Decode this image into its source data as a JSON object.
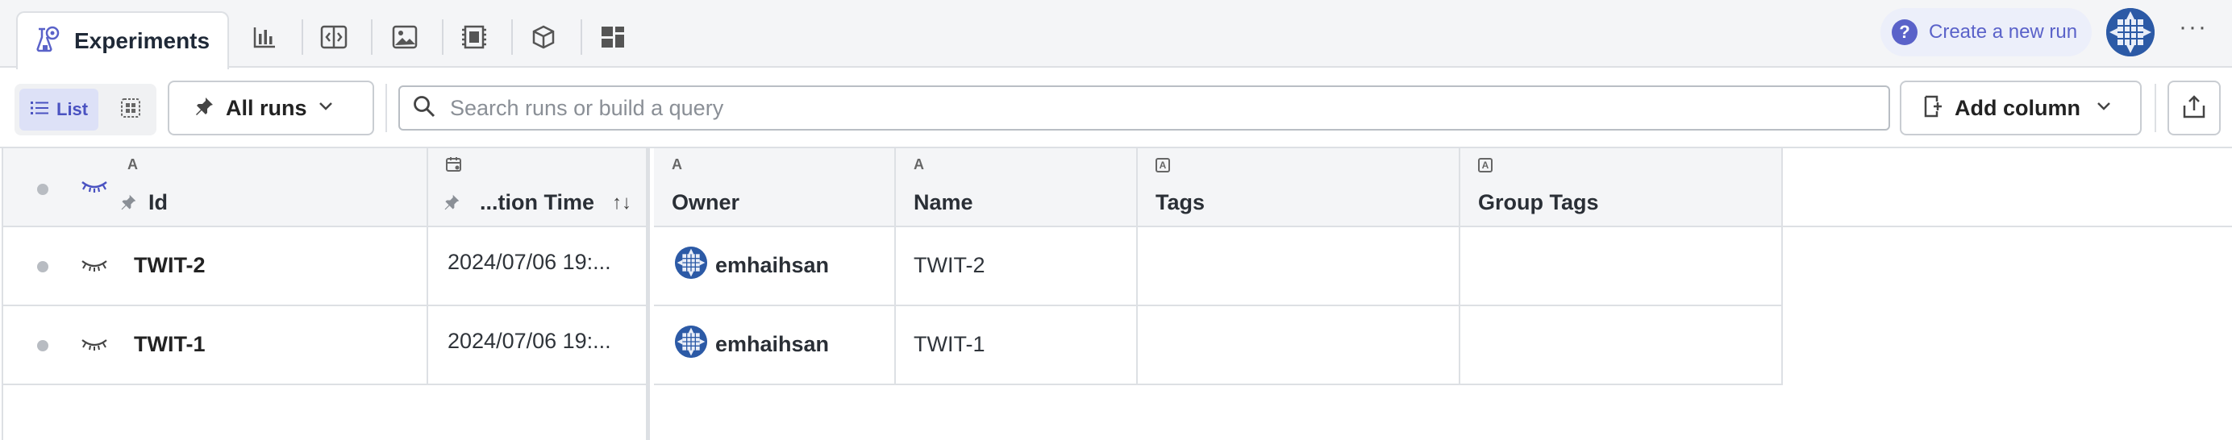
{
  "tabs": {
    "active_label": "Experiments",
    "icons": [
      "bar-chart-icon",
      "compare-icon",
      "image-icon",
      "film-icon",
      "cube-icon",
      "dashboard-icon"
    ]
  },
  "header_actions": {
    "create_run_label": "Create a new run",
    "more_label": "···"
  },
  "toolbar": {
    "view_list_label": "List",
    "all_runs_label": "All runs",
    "search_placeholder": "Search runs or build a query",
    "search_value": "",
    "add_column_label": "Add column"
  },
  "table": {
    "columns": [
      {
        "title": "Id",
        "type_marker": "A"
      },
      {
        "title": "...tion Time",
        "sort": "↑↓"
      },
      {
        "title": "Owner",
        "type_marker": "A"
      },
      {
        "title": "Name",
        "type_marker": "A"
      },
      {
        "title": "Tags",
        "type_marker": "A"
      },
      {
        "title": "Group Tags",
        "type_marker": "A"
      }
    ],
    "rows": [
      {
        "id": "TWIT-2",
        "creation_time": "2024/07/06 19:...",
        "owner": "emhaihsan",
        "name": "TWIT-2",
        "tags": "",
        "group_tags": ""
      },
      {
        "id": "TWIT-1",
        "creation_time": "2024/07/06 19:...",
        "owner": "emhaihsan",
        "name": "TWIT-1",
        "tags": "",
        "group_tags": ""
      }
    ]
  },
  "colors": {
    "accent": "#5a62c9",
    "avatar_blue": "#2c5aa6",
    "border": "#dde0e4",
    "header_bg": "#f4f5f7"
  }
}
